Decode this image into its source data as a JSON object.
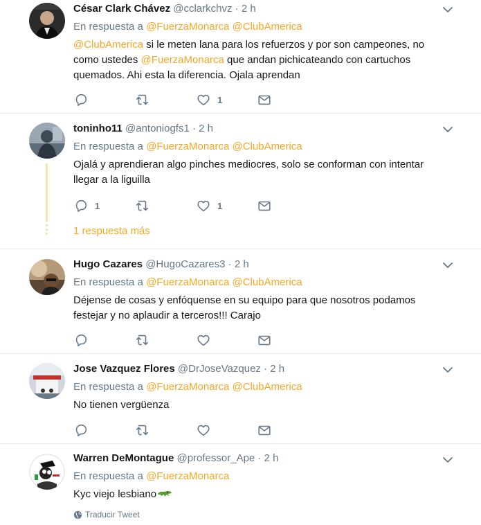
{
  "tweets": [
    {
      "name": "César Clark Chávez",
      "handle": "@cclarkchvz",
      "time": "2 h",
      "reply_prefix": "En respuesta a",
      "reply_mentions": [
        "@FuerzaMonarca",
        "@ClubAmerica"
      ],
      "text_parts": [
        "@ClubAmerica",
        "  si le meten lana para los refuerzos y por son campeones, no como ustedes ",
        "@FuerzaMonarca",
        " que andan pichicateando con cartuchos quemados. Ahi esta la diferencia. Ojala aprendan"
      ],
      "reply_count": "",
      "retweet_count": "",
      "like_count": "1"
    },
    {
      "name": "toninho11",
      "handle": "@antoniogfs1",
      "time": "2 h",
      "reply_prefix": "En respuesta a",
      "reply_mentions": [
        "@FuerzaMonarca",
        "@ClubAmerica"
      ],
      "text": "Ojalá y aprendieran algo pinches mediocres, solo se conforman con intentar llegar a la liguilla",
      "reply_count": "1",
      "retweet_count": "",
      "like_count": "1",
      "more_replies": "1 respuesta más"
    },
    {
      "name": "Hugo Cazares",
      "handle": "@HugoCazares3",
      "time": "2 h",
      "reply_prefix": "En respuesta a",
      "reply_mentions": [
        "@FuerzaMonarca",
        "@ClubAmerica"
      ],
      "text": "Déjense de cosas y enfóquense en su equipo para que nosotros podamos festejar y no aplaudir a terceros!!! Carajo",
      "reply_count": "",
      "retweet_count": "",
      "like_count": ""
    },
    {
      "name": "Jose Vazquez Flores",
      "handle": "@DrJoseVazquez",
      "time": "2 h",
      "reply_prefix": "En respuesta a",
      "reply_mentions": [
        "@FuerzaMonarca",
        "@ClubAmerica"
      ],
      "text": "No tienen vergüenza",
      "reply_count": "",
      "retweet_count": "",
      "like_count": ""
    },
    {
      "name": "Warren DeMontague",
      "handle": "@professor_Ape",
      "time": "2 h",
      "reply_prefix": "En respuesta a",
      "reply_mentions": [
        "@FuerzaMonarca"
      ],
      "text": "Kyc viejo lesbiano",
      "translate_label": "Traducir Tweet"
    }
  ],
  "dot": "·",
  "colors": {
    "accent": "#f5a623",
    "muted": "#657786",
    "text": "#14171a",
    "divider": "#e6ecf0"
  },
  "icons": [
    "reply-icon",
    "retweet-icon",
    "like-icon",
    "message-icon",
    "chevron-down-icon",
    "globe-icon",
    "crocodile-emoji"
  ]
}
